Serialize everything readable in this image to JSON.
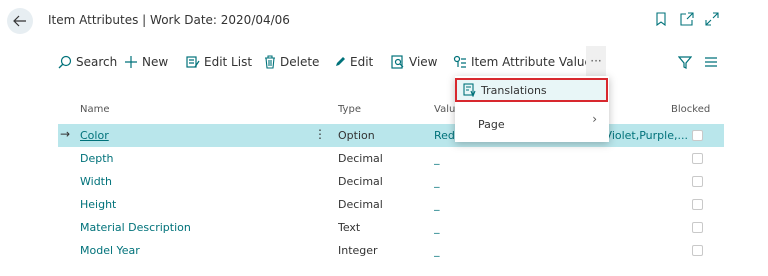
{
  "header": {
    "title": "Item Attributes | Work Date: 2020/04/06"
  },
  "toolbar": {
    "search": "Search",
    "new": "New",
    "edit_list": "Edit List",
    "delete": "Delete",
    "edit": "Edit",
    "view": "View",
    "item_attribute_values": "Item Attribute Values",
    "more": "···"
  },
  "columns": {
    "name": "Name",
    "type": "Type",
    "values": "Value",
    "blocked": "Blocked"
  },
  "rows": [
    {
      "name": "Color",
      "type": "Option",
      "values": "Red,Orange,Yellow,Green,Blue,Violet,Purple,..."
    },
    {
      "name": "Depth",
      "type": "Decimal",
      "values": "_"
    },
    {
      "name": "Width",
      "type": "Decimal",
      "values": "_"
    },
    {
      "name": "Height",
      "type": "Decimal",
      "values": "_"
    },
    {
      "name": "Material Description",
      "type": "Text",
      "values": "_"
    },
    {
      "name": "Model Year",
      "type": "Integer",
      "values": "_"
    }
  ],
  "dropdown": {
    "translations": "Translations",
    "page": "Page"
  },
  "colors": {
    "accent": "#00727a",
    "selected_row": "#b9e6eb",
    "highlight_border": "#d8282e"
  }
}
